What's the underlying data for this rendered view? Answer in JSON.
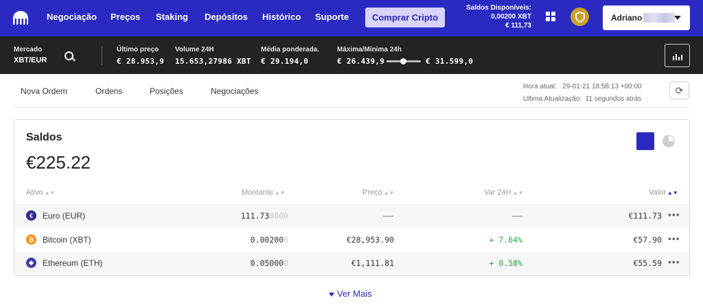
{
  "nav": {
    "items": [
      "Negociação",
      "Preços",
      "Staking",
      "Depósitos",
      "Histórico",
      "Suporte"
    ],
    "buy_label": "Comprar Cripto",
    "balances_title": "Saldos Disponíveis:",
    "balance_xbt": "0,00200 XBT",
    "balance_eur": "€ 111,73",
    "user_name": "Adriano"
  },
  "market": {
    "market_label": "Mercado",
    "pair": "XBT/EUR",
    "last_price_label": "Último preço",
    "last_price": "€ 28.953,9",
    "volume_label": "Volume 24H",
    "volume": "15.653,27986 XBT",
    "weighted_label": "Média ponderada.",
    "weighted": "€ 29.194,0",
    "range_label": "Máxima/Mínima 24h",
    "range_low": "€ 26.439,9",
    "range_high": "€ 31.599,0"
  },
  "tabs": [
    "Nova Ordem",
    "Ordens",
    "Posições",
    "Negociações"
  ],
  "time": {
    "current_label": "Hora atual:",
    "current": "29-01-21 18:58:13 +00:00",
    "updated_label": "Ultima Atualização:",
    "updated": "11 segundos atrás"
  },
  "balances": {
    "title": "Saldos",
    "total": "€225.22",
    "columns": [
      "Ativo",
      "Montante",
      "Preço",
      "Var 24H",
      "Valor"
    ],
    "rows": [
      {
        "asset": "Euro (EUR)",
        "amount_main": "111.73",
        "amount_dim": "0000",
        "price": "",
        "change": "",
        "value": "€111.73",
        "icon": "euro-coin-icon",
        "icon_glyph": "€",
        "icon_color": "#2a2a8a"
      },
      {
        "asset": "Bitcoin (XBT)",
        "amount_main": "0.00200",
        "amount_dim": "0",
        "price": "€28,953.90",
        "change": "+ 7.64%",
        "value": "€57.90",
        "icon": "bitcoin-coin-icon",
        "icon_glyph": "₿",
        "icon_color": "#f7931a"
      },
      {
        "asset": "Ethereum (ETH)",
        "amount_main": "0.05000",
        "amount_dim": "0",
        "price": "€1,111.81",
        "change": "+ 0.58%",
        "value": "€55.59",
        "icon": "ethereum-coin-icon",
        "icon_glyph": "◆",
        "icon_color": "#3c3ca8"
      }
    ]
  },
  "more_label": "Ver Mais",
  "colors": {
    "brand": "#2a2ac2",
    "positive": "#28a745"
  }
}
